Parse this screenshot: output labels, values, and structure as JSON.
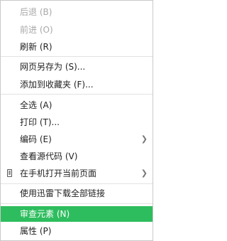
{
  "menu": {
    "back": "后退 (B)",
    "forward": "前进 (O)",
    "refresh": "刷新 (R)",
    "save_as": "网页另存为 (S)...",
    "add_favorite": "添加到收藏夹 (F)...",
    "select_all": "全选 (A)",
    "print": "打印 (T)...",
    "encoding": "编码 (E)",
    "view_source": "查看源代码 (V)",
    "open_on_phone": "在手机打开当前页面",
    "download_all_links": "使用迅雷下载全部链接",
    "inspect_element": "审查元素 (N)",
    "properties": "属性 (P)"
  },
  "colors": {
    "highlight": "#2ebd5e",
    "disabled_text": "#a8a8a8",
    "separator": "#e2e2e2"
  }
}
